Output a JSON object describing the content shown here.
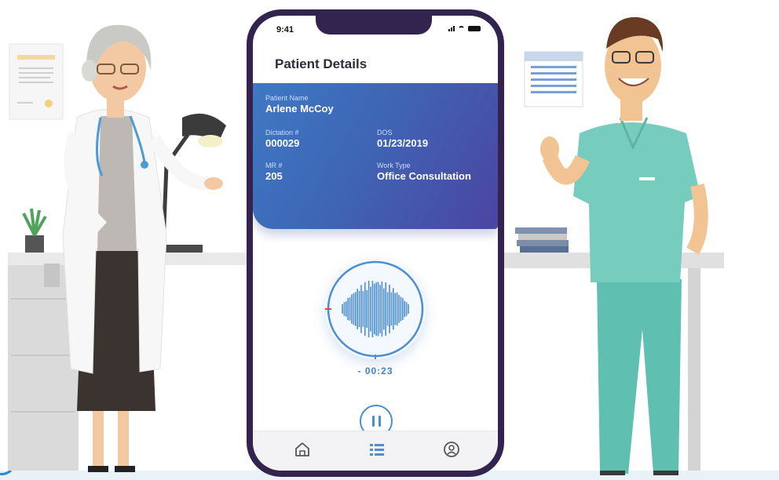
{
  "status_bar": {
    "time": "9:41"
  },
  "page": {
    "title": "Patient Details"
  },
  "patient": {
    "name_label": "Patient Name",
    "name": "Arlene McCoy",
    "dictation_label": "Dictation #",
    "dictation": "000029",
    "dos_label": "DOS",
    "dos": "01/23/2019",
    "mr_label": "MR #",
    "mr": "205",
    "work_type_label": "Work Type",
    "work_type": "Office Consultation"
  },
  "recorder": {
    "timer": "- 00:23",
    "state": "recording",
    "icons": {
      "control": "pause-icon"
    }
  },
  "bottom_nav": {
    "items": [
      {
        "icon": "home-icon"
      },
      {
        "icon": "list-icon"
      },
      {
        "icon": "profile-icon"
      }
    ]
  },
  "colors": {
    "card_gradient_start": "#3f78c4",
    "card_gradient_end": "#4b45a2",
    "accent": "#4c8ed2",
    "phone_frame": "#33244f"
  }
}
